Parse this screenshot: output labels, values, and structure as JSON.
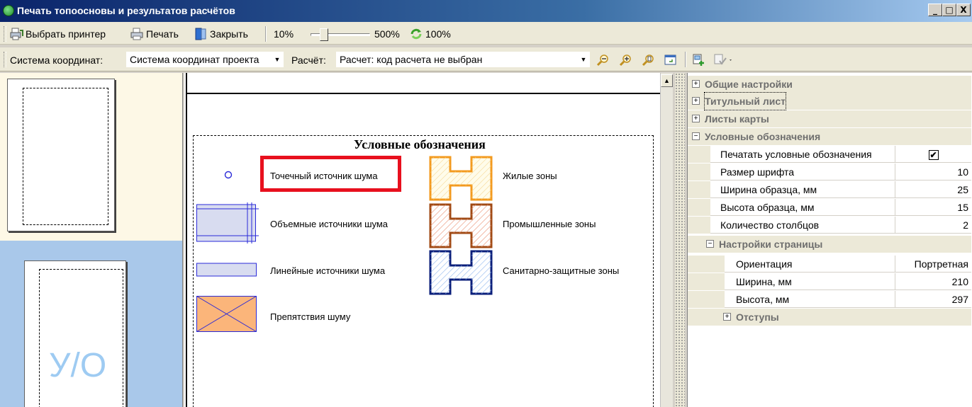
{
  "window": {
    "title": "Печать топоосновы и результатов расчётов",
    "controls": [
      "_",
      "□",
      "X"
    ]
  },
  "toolbar1": {
    "select_printer": "Выбрать принтер",
    "print": "Печать",
    "close": "Закрыть",
    "zoom_min": "10%",
    "zoom_max": "500%",
    "zoom_current": "100%",
    "zoom_level_fraction": 0.18
  },
  "toolbar2": {
    "coord_label": "Система координат:",
    "coord_value": "Система координат проекта",
    "calc_label": "Расчёт:",
    "calc_value": "Расчет: код расчета не выбран"
  },
  "thumbnails": {
    "page2_text": "У/О"
  },
  "legend": {
    "title": "Условные обозначения",
    "items": {
      "point_source": "Точечный источник шума",
      "volume_sources": "Объемные источники шума",
      "line_sources": "Линейные источники шума",
      "obstacles": "Препятствия шуму",
      "residential": "Жилые зоны",
      "industrial": "Промышленные зоны",
      "sanitary": "Санитарно-защитные зоны"
    },
    "colors": {
      "highlight": "#e8101e",
      "residential": "#f39a1e",
      "industrial": "#a04a14",
      "sanitary": "#0a1e7a",
      "obstacle_fill": "#fbb57a",
      "source_blue": "#2a2ad8"
    }
  },
  "properties": {
    "general": "Общие настройки",
    "title_sheet": "Титульный лист",
    "map_sheets": "Листы карты",
    "legend": "Условные обозначения",
    "rows": [
      {
        "name": "Печатать условные обозначения",
        "value": "✔"
      },
      {
        "name": "Размер шрифта",
        "value": "10"
      },
      {
        "name": "Ширина образца, мм",
        "value": "25"
      },
      {
        "name": "Высота образца, мм",
        "value": "15"
      },
      {
        "name": "Количество столбцов",
        "value": "2"
      }
    ],
    "page_settings": "Настройки страницы",
    "page_rows": [
      {
        "name": "Ориентация",
        "value": "Портретная"
      },
      {
        "name": "Ширина, мм",
        "value": "210"
      },
      {
        "name": "Высота, мм",
        "value": "297"
      }
    ],
    "margins": "Отступы"
  }
}
